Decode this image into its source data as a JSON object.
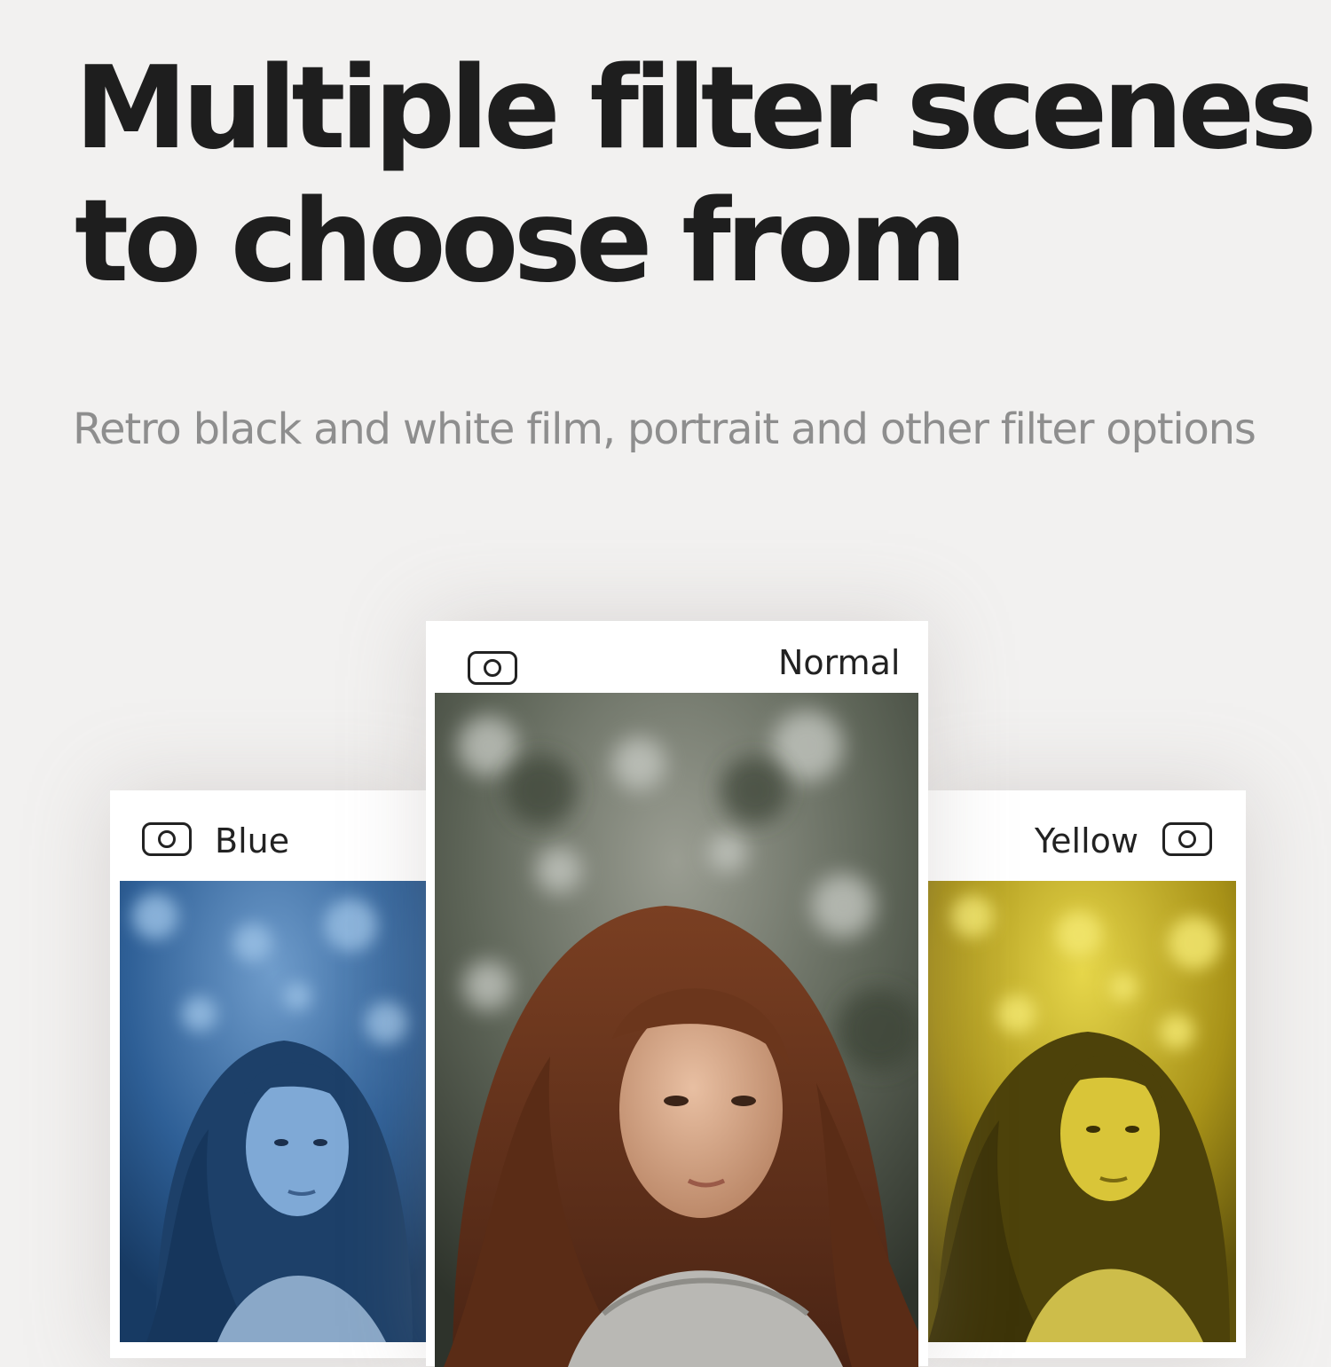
{
  "headline": {
    "line1": "Multiple filter scenes",
    "line2": "to choose from"
  },
  "subtitle": "Retro black and white film, portrait and other filter options",
  "cards": {
    "blue": {
      "label": "Blue",
      "icon": "camera-icon",
      "tint": "#2a5f9a"
    },
    "normal": {
      "label": "Normal",
      "icon": "camera-icon",
      "tint": "#6b4a30"
    },
    "yellow": {
      "label": "Yellow",
      "icon": "camera-icon",
      "tint": "#c2ac1e"
    }
  }
}
